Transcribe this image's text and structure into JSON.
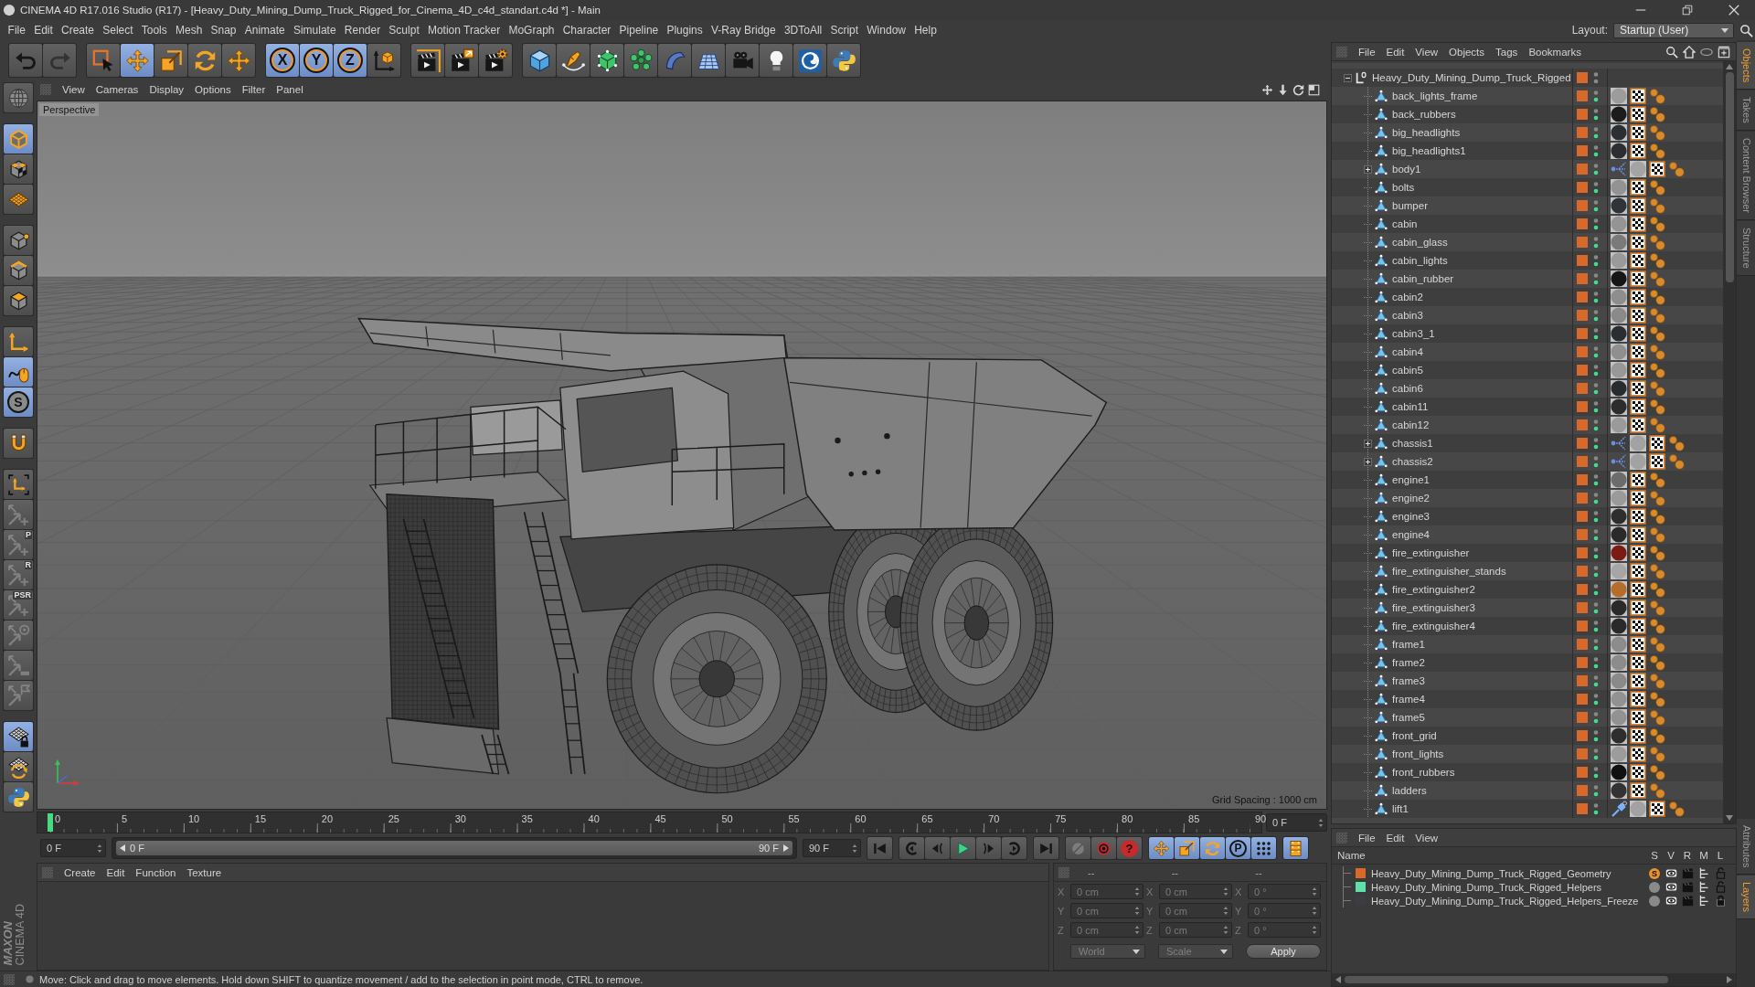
{
  "window": {
    "title": "CINEMA 4D R17.016 Studio (R17) - [Heavy_Duty_Mining_Dump_Truck_Rigged_for_Cinema_4D_c4d_standart.c4d *] - Main"
  },
  "menu_bar": {
    "items": [
      "File",
      "Edit",
      "Create",
      "Select",
      "Tools",
      "Mesh",
      "Snap",
      "Animate",
      "Simulate",
      "Render",
      "Sculpt",
      "Motion Tracker",
      "MoGraph",
      "Character",
      "Pipeline",
      "Plugins",
      "V-Ray Bridge",
      "3DToAll",
      "Script",
      "Window",
      "Help"
    ],
    "layout_label": "Layout:",
    "layout_value": "Startup (User)"
  },
  "toolbar": {
    "groups": [
      [
        {
          "kind": "undo",
          "selected": false,
          "disabled": false
        },
        {
          "kind": "redo",
          "selected": false,
          "disabled": true
        }
      ],
      [
        {
          "kind": "select",
          "selected": false,
          "disabled": false
        },
        {
          "kind": "move",
          "selected": true,
          "disabled": false
        },
        {
          "kind": "scale",
          "selected": false,
          "disabled": false
        },
        {
          "kind": "rotate",
          "selected": false,
          "disabled": false
        },
        {
          "kind": "move-small",
          "selected": false,
          "disabled": false
        }
      ],
      [
        {
          "kind": "axis",
          "label": "X",
          "selected": true,
          "disabled": false
        },
        {
          "kind": "axis",
          "label": "Y",
          "selected": true,
          "disabled": false
        },
        {
          "kind": "axis",
          "label": "Z",
          "selected": true,
          "disabled": false
        },
        {
          "kind": "coords",
          "selected": false,
          "disabled": false
        }
      ],
      [
        {
          "kind": "render-view",
          "selected": false,
          "disabled": false
        },
        {
          "kind": "render-viewer",
          "selected": false,
          "disabled": false
        },
        {
          "kind": "render-settings",
          "selected": false,
          "disabled": false
        }
      ],
      [
        {
          "kind": "cube",
          "selected": false,
          "disabled": false
        },
        {
          "kind": "pen",
          "selected": false,
          "disabled": false
        },
        {
          "kind": "subdivision",
          "selected": false,
          "disabled": false
        },
        {
          "kind": "cloner",
          "selected": false,
          "disabled": false
        },
        {
          "kind": "deformer",
          "selected": false,
          "disabled": false
        },
        {
          "kind": "floor",
          "selected": false,
          "disabled": false
        },
        {
          "kind": "camera",
          "selected": false,
          "disabled": false
        },
        {
          "kind": "light",
          "selected": false,
          "disabled": false
        },
        {
          "kind": "swirl",
          "selected": false,
          "disabled": false
        },
        {
          "kind": "python",
          "selected": false,
          "disabled": false
        }
      ]
    ]
  },
  "left_toolbar": {
    "groups": [
      [
        {
          "kind": "globe",
          "selected": false,
          "disabled": false
        }
      ],
      [
        {
          "kind": "model",
          "selected": true,
          "disabled": false
        },
        {
          "kind": "texture",
          "selected": false,
          "disabled": false
        },
        {
          "kind": "workplane",
          "selected": false,
          "disabled": false
        }
      ],
      [
        {
          "kind": "points",
          "selected": false,
          "disabled": false
        },
        {
          "kind": "edges",
          "selected": false,
          "disabled": false
        },
        {
          "kind": "polygons",
          "selected": false,
          "disabled": false
        }
      ],
      [
        {
          "kind": "axis-l",
          "selected": false,
          "disabled": false
        },
        {
          "kind": "tweak",
          "selected": true,
          "disabled": false
        },
        {
          "kind": "snap",
          "label": "S",
          "selected": true,
          "disabled": false
        }
      ],
      [
        {
          "kind": "magnet",
          "selected": false,
          "disabled": false
        }
      ],
      [
        {
          "kind": "corner-axis",
          "selected": false,
          "disabled": false
        },
        {
          "kind": "quantize",
          "selected": false,
          "disabled": true
        },
        {
          "kind": "quantize",
          "label": "P",
          "selected": false,
          "disabled": true
        },
        {
          "kind": "quantize",
          "label": "R",
          "selected": false,
          "disabled": true
        },
        {
          "kind": "quantize",
          "label": "PSR",
          "selected": false,
          "disabled": true
        },
        {
          "kind": "quantize-target",
          "selected": false,
          "disabled": true
        },
        {
          "kind": "quantize-bar",
          "selected": false,
          "disabled": true
        },
        {
          "kind": "quantize-flag",
          "selected": false,
          "disabled": true
        }
      ],
      [
        {
          "kind": "grid-lock",
          "selected": true,
          "disabled": false
        },
        {
          "kind": "grid-rotate",
          "selected": false,
          "disabled": false
        },
        {
          "kind": "python",
          "selected": false,
          "disabled": false
        }
      ]
    ]
  },
  "brand": {
    "maxon": "MAXON",
    "product": "CINEMA 4D"
  },
  "viewport": {
    "menu": [
      "View",
      "Cameras",
      "Display",
      "Options",
      "Filter",
      "Panel"
    ],
    "camera_label": "Perspective",
    "grid_spacing": "Grid Spacing : 1000 cm"
  },
  "timeline": {
    "ticks": [
      "0",
      "5",
      "10",
      "15",
      "20",
      "25",
      "30",
      "35",
      "40",
      "45",
      "50",
      "55",
      "60",
      "65",
      "70",
      "75",
      "80",
      "85",
      "90"
    ],
    "playhead": {
      "level": 0
    },
    "current_frame": "0 F"
  },
  "playback": {
    "start_field": "0 F",
    "range": {
      "start": "0 F",
      "end": "90 F",
      "level": 1
    },
    "end_field": "90 F",
    "transport": [
      [
        {
          "kind": "to-start"
        }
      ],
      [
        {
          "kind": "prev-key"
        },
        {
          "kind": "prev-frame"
        },
        {
          "kind": "play"
        },
        {
          "kind": "next-frame"
        },
        {
          "kind": "next-key"
        }
      ],
      [
        {
          "kind": "to-end"
        }
      ],
      [
        {
          "kind": "record-off"
        },
        {
          "kind": "autokey"
        },
        {
          "kind": "key-selection",
          "label": "?"
        }
      ]
    ],
    "key_modes": [
      [
        {
          "kind": "key-move",
          "selected": true
        },
        {
          "kind": "key-scale",
          "selected": true
        },
        {
          "kind": "key-rotate",
          "selected": true
        },
        {
          "kind": "key-param",
          "label": "P",
          "selected": true
        },
        {
          "kind": "key-points",
          "selected": true
        }
      ],
      [
        {
          "kind": "dopesheet",
          "selected": true
        }
      ]
    ]
  },
  "material_manager": {
    "menu": [
      "Create",
      "Edit",
      "Function",
      "Texture"
    ]
  },
  "coordinates": {
    "disabled": true,
    "headers": [
      "--",
      "--",
      "--"
    ],
    "rows": [
      {
        "axis": "X",
        "position": "0 cm",
        "size_axis": "X",
        "size": "0 cm",
        "rotation_axis": "X",
        "rotation": "0 °"
      },
      {
        "axis": "Y",
        "position": "0 cm",
        "size_axis": "Y",
        "size": "0 cm",
        "rotation_axis": "Y",
        "rotation": "0 °"
      },
      {
        "axis": "Z",
        "position": "0 cm",
        "size_axis": "Z",
        "size": "0 cm",
        "rotation_axis": "Z",
        "rotation": "0 °"
      }
    ],
    "space": "World",
    "mode": "Scale",
    "apply": "Apply"
  },
  "status_bar": {
    "message": "Move: Click and drag to move elements. Hold down SHIFT to quantize movement / add to the selection in point mode, CTRL to remove."
  },
  "object_manager": {
    "menu": [
      "File",
      "Edit",
      "View",
      "Objects",
      "Tags",
      "Bookmarks"
    ],
    "objects": [
      {
        "name": "Heavy_Duty_Mining_Dump_Truck_Rigged",
        "kind": "null",
        "expanded": true,
        "selected": false,
        "render_on": false,
        "children": [
          {
            "name": "back_lights_frame",
            "kind": "polygon",
            "selected": false,
            "render_on": true,
            "tags": [
              {
                "kind": "material",
                "color": "#9c9c9c"
              },
              {
                "kind": "texture"
              },
              {
                "kind": "uvw"
              }
            ]
          },
          {
            "name": "back_rubbers",
            "kind": "polygon",
            "selected": false,
            "render_on": true,
            "tags": [
              {
                "kind": "material",
                "color": "#1c1c1c"
              },
              {
                "kind": "texture"
              },
              {
                "kind": "uvw"
              }
            ]
          },
          {
            "name": "big_headlights",
            "kind": "polygon",
            "selected": false,
            "render_on": true,
            "tags": [
              {
                "kind": "material",
                "color": "#2b2e33"
              },
              {
                "kind": "texture"
              },
              {
                "kind": "uvw"
              }
            ]
          },
          {
            "name": "big_headlights1",
            "kind": "polygon",
            "selected": false,
            "render_on": true,
            "tags": [
              {
                "kind": "material",
                "color": "#2b2e33"
              },
              {
                "kind": "texture"
              },
              {
                "kind": "uvw"
              }
            ]
          },
          {
            "name": "body1",
            "kind": "polygon",
            "expanded": false,
            "selected": false,
            "render_on": true,
            "tags": [
              {
                "kind": "branch"
              },
              {
                "kind": "material",
                "color": "#a4a4a4"
              },
              {
                "kind": "texture"
              },
              {
                "kind": "uvw"
              }
            ]
          },
          {
            "name": "bolts",
            "kind": "polygon",
            "selected": false,
            "render_on": true,
            "tags": [
              {
                "kind": "material",
                "color": "#939393"
              },
              {
                "kind": "texture"
              },
              {
                "kind": "uvw"
              }
            ]
          },
          {
            "name": "bumper",
            "kind": "polygon",
            "selected": false,
            "render_on": true,
            "tags": [
              {
                "kind": "material",
                "color": "#2f333a"
              },
              {
                "kind": "texture"
              },
              {
                "kind": "uvw"
              }
            ]
          },
          {
            "name": "cabin",
            "kind": "polygon",
            "selected": false,
            "render_on": true,
            "tags": [
              {
                "kind": "material",
                "color": "#949494"
              },
              {
                "kind": "texture"
              },
              {
                "kind": "uvw"
              }
            ]
          },
          {
            "name": "cabin_glass",
            "kind": "polygon",
            "selected": false,
            "render_on": true,
            "tags": [
              {
                "kind": "material",
                "color": "#7a7a7a"
              },
              {
                "kind": "texture"
              },
              {
                "kind": "uvw"
              }
            ]
          },
          {
            "name": "cabin_lights",
            "kind": "polygon",
            "selected": false,
            "render_on": true,
            "tags": [
              {
                "kind": "material",
                "color": "#9a9a9a"
              },
              {
                "kind": "texture"
              },
              {
                "kind": "uvw"
              }
            ]
          },
          {
            "name": "cabin_rubber",
            "kind": "polygon",
            "selected": false,
            "render_on": true,
            "tags": [
              {
                "kind": "material",
                "color": "#161616"
              },
              {
                "kind": "texture"
              },
              {
                "kind": "uvw"
              }
            ]
          },
          {
            "name": "cabin2",
            "kind": "polygon",
            "selected": false,
            "render_on": true,
            "tags": [
              {
                "kind": "material",
                "color": "#8e8e8e"
              },
              {
                "kind": "texture"
              },
              {
                "kind": "uvw"
              }
            ]
          },
          {
            "name": "cabin3",
            "kind": "polygon",
            "selected": false,
            "render_on": true,
            "tags": [
              {
                "kind": "material",
                "color": "#8a8a8a"
              },
              {
                "kind": "texture"
              },
              {
                "kind": "uvw"
              }
            ]
          },
          {
            "name": "cabin3_1",
            "kind": "polygon",
            "selected": false,
            "render_on": true,
            "tags": [
              {
                "kind": "material",
                "color": "#2a2d31"
              },
              {
                "kind": "texture"
              },
              {
                "kind": "uvw"
              }
            ]
          },
          {
            "name": "cabin4",
            "kind": "polygon",
            "selected": false,
            "render_on": true,
            "tags": [
              {
                "kind": "material",
                "color": "#8f8f8f"
              },
              {
                "kind": "texture"
              },
              {
                "kind": "uvw"
              }
            ]
          },
          {
            "name": "cabin5",
            "kind": "polygon",
            "selected": false,
            "render_on": true,
            "tags": [
              {
                "kind": "material",
                "color": "#989898"
              },
              {
                "kind": "texture"
              },
              {
                "kind": "uvw"
              }
            ]
          },
          {
            "name": "cabin6",
            "kind": "polygon",
            "selected": false,
            "render_on": true,
            "tags": [
              {
                "kind": "material",
                "color": "#282b2f"
              },
              {
                "kind": "texture"
              },
              {
                "kind": "uvw"
              }
            ]
          },
          {
            "name": "cabin11",
            "kind": "polygon",
            "selected": false,
            "render_on": true,
            "tags": [
              {
                "kind": "material",
                "color": "#2c2c2c"
              },
              {
                "kind": "texture"
              },
              {
                "kind": "uvw"
              }
            ]
          },
          {
            "name": "cabin12",
            "kind": "polygon",
            "selected": false,
            "render_on": true,
            "tags": [
              {
                "kind": "material",
                "color": "#9a9a9a"
              },
              {
                "kind": "texture"
              },
              {
                "kind": "uvw"
              }
            ]
          },
          {
            "name": "chassis1",
            "kind": "polygon",
            "expanded": false,
            "selected": false,
            "render_on": true,
            "tags": [
              {
                "kind": "branch"
              },
              {
                "kind": "material",
                "color": "#a2a2a2"
              },
              {
                "kind": "texture"
              },
              {
                "kind": "uvw"
              }
            ]
          },
          {
            "name": "chassis2",
            "kind": "polygon",
            "expanded": false,
            "selected": false,
            "render_on": true,
            "tags": [
              {
                "kind": "branch"
              },
              {
                "kind": "material",
                "color": "#a2a2a2"
              },
              {
                "kind": "texture"
              },
              {
                "kind": "uvw"
              }
            ]
          },
          {
            "name": "engine1",
            "kind": "polygon",
            "selected": false,
            "render_on": true,
            "tags": [
              {
                "kind": "material",
                "color": "#6c6c6c"
              },
              {
                "kind": "texture"
              },
              {
                "kind": "uvw"
              }
            ]
          },
          {
            "name": "engine2",
            "kind": "polygon",
            "selected": false,
            "render_on": true,
            "tags": [
              {
                "kind": "material",
                "color": "#9a9a9a"
              },
              {
                "kind": "texture"
              },
              {
                "kind": "uvw"
              }
            ]
          },
          {
            "name": "engine3",
            "kind": "polygon",
            "selected": false,
            "render_on": true,
            "tags": [
              {
                "kind": "material",
                "color": "#2e2e2e"
              },
              {
                "kind": "texture"
              },
              {
                "kind": "uvw"
              }
            ]
          },
          {
            "name": "engine4",
            "kind": "polygon",
            "selected": false,
            "render_on": true,
            "tags": [
              {
                "kind": "material",
                "color": "#2a2a2a"
              },
              {
                "kind": "texture"
              },
              {
                "kind": "uvw"
              }
            ]
          },
          {
            "name": "fire_extinguisher",
            "kind": "polygon",
            "selected": false,
            "render_on": true,
            "tags": [
              {
                "kind": "material",
                "color": "#7a1c14"
              },
              {
                "kind": "texture"
              },
              {
                "kind": "uvw"
              }
            ]
          },
          {
            "name": "fire_extinguisher_stands",
            "kind": "polygon",
            "selected": false,
            "render_on": true,
            "tags": [
              {
                "kind": "material",
                "color": "#a6a6a6"
              },
              {
                "kind": "texture"
              },
              {
                "kind": "uvw"
              }
            ]
          },
          {
            "name": "fire_extinguisher2",
            "kind": "polygon",
            "selected": false,
            "render_on": true,
            "tags": [
              {
                "kind": "material",
                "color": "#b46e2a"
              },
              {
                "kind": "texture"
              },
              {
                "kind": "uvw"
              }
            ]
          },
          {
            "name": "fire_extinguisher3",
            "kind": "polygon",
            "selected": false,
            "render_on": true,
            "tags": [
              {
                "kind": "material",
                "color": "#2a2a2a"
              },
              {
                "kind": "texture"
              },
              {
                "kind": "uvw"
              }
            ]
          },
          {
            "name": "fire_extinguisher4",
            "kind": "polygon",
            "selected": false,
            "render_on": true,
            "tags": [
              {
                "kind": "material",
                "color": "#2a2a2a"
              },
              {
                "kind": "texture"
              },
              {
                "kind": "uvw"
              }
            ]
          },
          {
            "name": "frame1",
            "kind": "polygon",
            "selected": false,
            "render_on": true,
            "tags": [
              {
                "kind": "material",
                "color": "#8c8c8c"
              },
              {
                "kind": "texture"
              },
              {
                "kind": "uvw"
              }
            ]
          },
          {
            "name": "frame2",
            "kind": "polygon",
            "selected": false,
            "render_on": true,
            "tags": [
              {
                "kind": "material",
                "color": "#8c8c8c"
              },
              {
                "kind": "texture"
              },
              {
                "kind": "uvw"
              }
            ]
          },
          {
            "name": "frame3",
            "kind": "polygon",
            "selected": false,
            "render_on": true,
            "tags": [
              {
                "kind": "material",
                "color": "#8a8a8a"
              },
              {
                "kind": "texture"
              },
              {
                "kind": "uvw"
              }
            ]
          },
          {
            "name": "frame4",
            "kind": "polygon",
            "selected": false,
            "render_on": true,
            "tags": [
              {
                "kind": "material",
                "color": "#929292"
              },
              {
                "kind": "texture"
              },
              {
                "kind": "uvw"
              }
            ]
          },
          {
            "name": "frame5",
            "kind": "polygon",
            "selected": false,
            "render_on": true,
            "tags": [
              {
                "kind": "material",
                "color": "#929292"
              },
              {
                "kind": "texture"
              },
              {
                "kind": "uvw"
              }
            ]
          },
          {
            "name": "front_grid",
            "kind": "polygon",
            "selected": false,
            "render_on": true,
            "tags": [
              {
                "kind": "material",
                "color": "#2e2e2e"
              },
              {
                "kind": "texture"
              },
              {
                "kind": "uvw"
              }
            ]
          },
          {
            "name": "front_lights",
            "kind": "polygon",
            "selected": false,
            "render_on": true,
            "tags": [
              {
                "kind": "material",
                "color": "#9c9c9c"
              },
              {
                "kind": "texture"
              },
              {
                "kind": "uvw"
              }
            ]
          },
          {
            "name": "front_rubbers",
            "kind": "polygon",
            "selected": false,
            "render_on": true,
            "tags": [
              {
                "kind": "material",
                "color": "#111111"
              },
              {
                "kind": "texture"
              },
              {
                "kind": "uvw"
              }
            ]
          },
          {
            "name": "ladders",
            "kind": "polygon",
            "selected": false,
            "render_on": true,
            "tags": [
              {
                "kind": "material",
                "color": "#333333"
              },
              {
                "kind": "texture"
              },
              {
                "kind": "uvw"
              }
            ]
          },
          {
            "name": "lift1",
            "kind": "polygon",
            "selected": false,
            "render_on": true,
            "tags": [
              {
                "kind": "pin"
              },
              {
                "kind": "material",
                "color": "#a2a2a2"
              },
              {
                "kind": "texture"
              },
              {
                "kind": "uvw"
              }
            ]
          }
        ]
      }
    ]
  },
  "layer_manager": {
    "menu": [
      "File",
      "Edit",
      "View"
    ],
    "columns": [
      "Name",
      "S",
      "V",
      "R",
      "M",
      "L"
    ],
    "layers": [
      {
        "name": "Heavy_Duty_Mining_Dump_Truck_Rigged_Geometry",
        "color": "#d9692a",
        "solo": true,
        "solo_mark": "S",
        "view": true,
        "render": true,
        "manager": true,
        "locked": false
      },
      {
        "name": "Heavy_Duty_Mining_Dump_Truck_Rigged_Helpers",
        "color": "#5fe0a8",
        "solo": false,
        "view": true,
        "render": true,
        "manager": true,
        "locked": false
      },
      {
        "name": "Heavy_Duty_Mining_Dump_Truck_Rigged_Helpers_Freeze",
        "color": "#3c3c44",
        "solo": false,
        "view": true,
        "render": true,
        "manager": true,
        "locked": true
      }
    ]
  },
  "side_tabs": {
    "top": [
      {
        "label": "Objects",
        "selected": true
      },
      {
        "label": "Takes",
        "selected": false
      },
      {
        "label": "Content Browser",
        "selected": false
      },
      {
        "label": "Structure",
        "selected": false
      }
    ],
    "bottom": [
      {
        "label": "Attributes",
        "selected": false
      },
      {
        "label": "Layers",
        "selected": true
      }
    ]
  }
}
